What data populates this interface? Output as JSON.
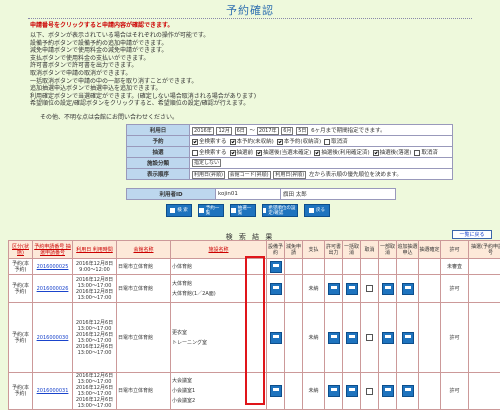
{
  "page_title": "予約確認",
  "notice": "申請番号をクリックすると申請内容が確認できます。",
  "info_lines": [
    "以下、ボタンが表示されている場合はそれぞれの操作が可能です。",
    "設備予約ボタンで設備予約の追加申請ができます。",
    "減免申請ボタンで使用料金の減免申請ができます。",
    "支払ボタンで使用料金の支払いができます。",
    "許可書ボタンで許可書を出力できます。",
    "取消ボタンで申請の取消ができます。",
    "一括取消ボタンで申請の中の一部を取り消すことができます。",
    "追加抽選申込ボタンで抽選申込を追加できます。",
    "利用確定ボタンで当選確定ができます。(確定しない場合取消される場合があります)",
    "希望順位の設定/確認ボタンをクリックすると、希望順位の設定/確認が行えます。"
  ],
  "contact": "その他、不明な点は会館にお問い合わせください。",
  "search": {
    "labels": {
      "period": "利用日",
      "reservation": "予約",
      "lottery": "抽選",
      "facility_class": "施設分類",
      "order": "表示順序"
    },
    "period": {
      "from_year": "2016年",
      "from_month": "12月",
      "from_day": "6日",
      "sep": "～",
      "to_year": "2017年",
      "to_month": "6月",
      "to_day": "5日",
      "hint": "6ヶ月まで期間指定できます。"
    },
    "reservation_opts": [
      {
        "label": "全検索する",
        "on": true
      },
      {
        "label": "本予約(未収納)",
        "on": true
      },
      {
        "label": "本予約(収納済)",
        "on": true
      },
      {
        "label": "取消済",
        "on": false
      }
    ],
    "lottery_opts": [
      {
        "label": "全検索する",
        "on": false
      },
      {
        "label": "抽選前",
        "on": true
      },
      {
        "label": "抽選後(当選未確定)",
        "on": true
      },
      {
        "label": "抽選後(利用確定済)",
        "on": true
      },
      {
        "label": "抽選後(落選)",
        "on": true
      },
      {
        "label": "取消済",
        "on": false
      }
    ],
    "facility_class_value": "指定しない",
    "order": {
      "first": "利用日(昇順)",
      "second": "会館コード(昇順)",
      "third": "利用日(昇順)",
      "hint": "左から表示順の優先順位を決めます。"
    }
  },
  "user": {
    "id_label": "利用者ID",
    "id_value": "kojin01",
    "name_value": "旗田 太郎"
  },
  "actions": [
    {
      "label": "検 索"
    },
    {
      "label": "予約一覧"
    },
    {
      "label": "抽選一覧"
    },
    {
      "label": "希望順位の設定/確認"
    },
    {
      "label": "戻る"
    }
  ],
  "results_label": "検 索 結 果",
  "back_link": "一覧に戻る",
  "columns": [
    "区分(状態)",
    "予約申請番号 抽選申請番号",
    "利用日 利用時間",
    "会館名称",
    "施設名称",
    "設備予約",
    "減免申請",
    "支払",
    "許可書出力",
    "一括取消",
    "取消",
    "一部取消",
    "追加抽選申込",
    "抽選確定",
    "許可",
    "抽選(予約申請)番号"
  ],
  "rows": [
    {
      "status": "予約(本予約)",
      "number": "2016000025",
      "dates": [
        "2016年12月8日 9:00～12:00"
      ],
      "hall": "日電市立体育館",
      "facilities": [
        "小体育館"
      ],
      "pay": "",
      "permit": "未審査"
    },
    {
      "status": "予約(本予約)",
      "number": "2016000026",
      "dates": [
        "2016年12月8日 13:00～17:00",
        "2016年12月8日 13:00～17:00"
      ],
      "hall": "日電市立体育館",
      "facilities": [
        "大体育館",
        "大体育館(1／2A面)"
      ],
      "pay": "未納",
      "permit": "許可"
    },
    {
      "status": "予約(本予約)",
      "number": "2016000030",
      "dates": [
        "2016年12月6日 13:00～17:00",
        "2016年12月6日 13:00～17:00",
        "2016年12月6日 13:00～17:00"
      ],
      "hall": "日電市立体育館",
      "facilities": [
        "更衣室",
        "トレーニング室"
      ],
      "pay": "未納",
      "permit": "許可"
    },
    {
      "status": "予約(本予約)",
      "number": "2016000031",
      "dates": [
        "2016年12月6日 13:00～17:00",
        "2016年12月6日 13:00～17:00",
        "2016年12月6日 13:00～17:00"
      ],
      "hall": "日電市立体育館",
      "facilities": [
        "大会議室",
        "小会議室1",
        "小会議室2"
      ],
      "pay": "未納",
      "permit": "許可"
    }
  ]
}
